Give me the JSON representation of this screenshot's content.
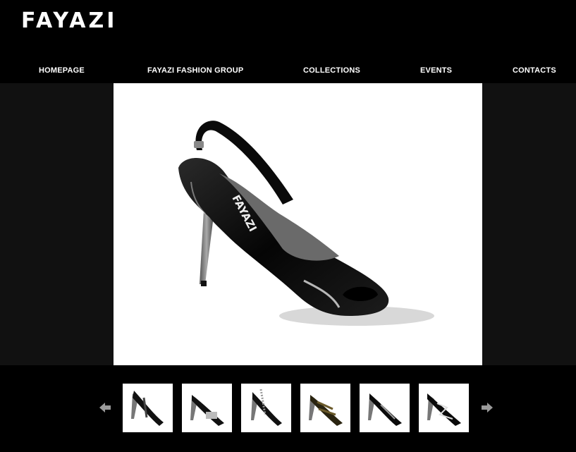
{
  "brand": {
    "logo_text": "FAYAZI"
  },
  "nav": {
    "items": [
      {
        "label": "HOMEPAGE"
      },
      {
        "label": "FAYAZI FASHION GROUP"
      },
      {
        "label": "COLLECTIONS"
      },
      {
        "label": "EVENTS"
      },
      {
        "label": "CONTACTS"
      }
    ]
  },
  "main_image": {
    "insole_brand": "FAYAZI",
    "subject": "black patent slingback peep-toe high heel"
  },
  "gallery": {
    "prev_icon": "left-arrow-icon",
    "next_icon": "right-arrow-icon",
    "thumbnails_count_visible": 6
  },
  "colors": {
    "background": "#000000",
    "stage": "#111111",
    "photo_bg": "#ffffff",
    "text": "#ffffff",
    "arrow": "#9a9a9a"
  }
}
